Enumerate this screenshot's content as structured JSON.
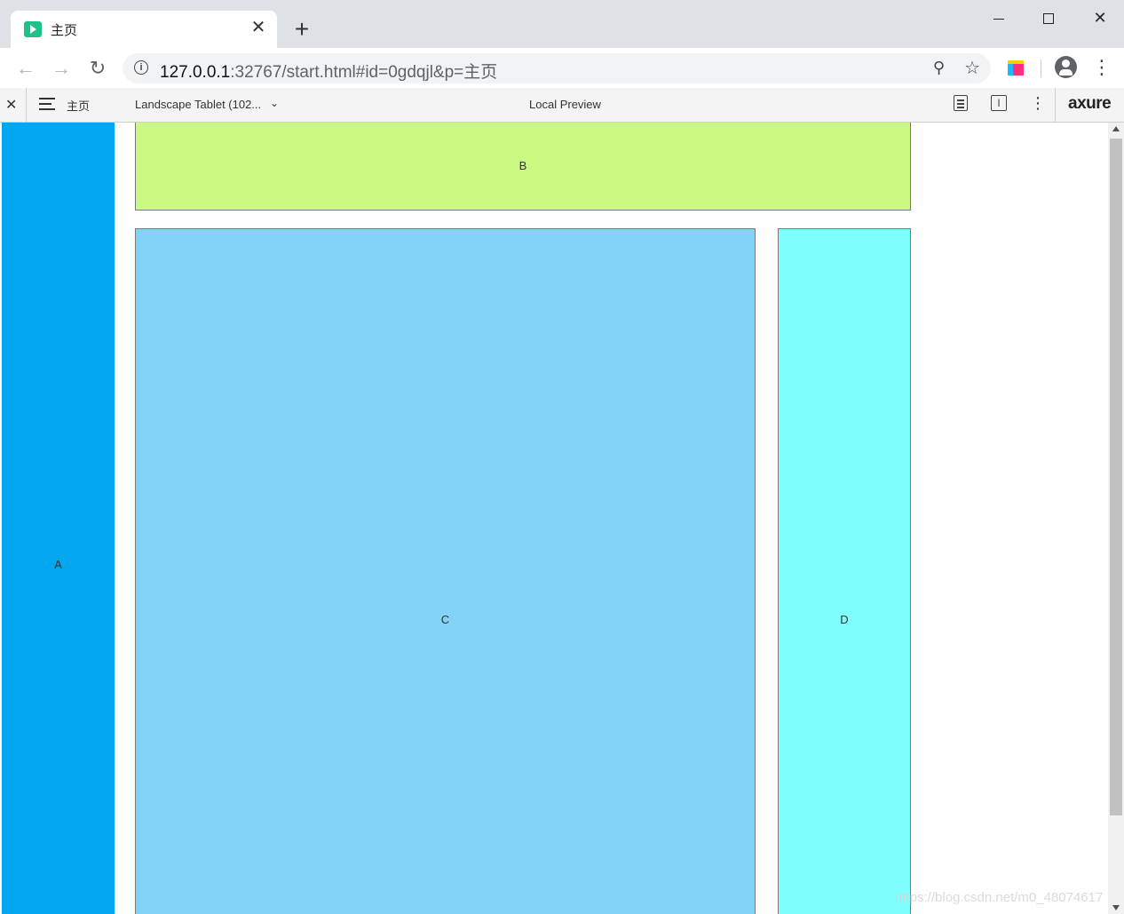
{
  "browser": {
    "tab_title": "主页",
    "new_tab": "+",
    "tab_close": "✕",
    "url_host": "127.0.0.1",
    "url_rest": ":32767/start.html#id=0gdqjl&p=主页"
  },
  "axure": {
    "close": "✕",
    "page_name": "主页",
    "device": "Landscape Tablet (102...",
    "preview_label": "Local Preview",
    "logo": "axure"
  },
  "canvas": {
    "box_a": "A",
    "box_b": "B",
    "box_c": "C",
    "box_d": "D"
  },
  "watermark": "https://blog.csdn.net/m0_48074617",
  "colors": {
    "box_a": "#02a7f0",
    "box_b": "#caf982",
    "box_c": "#81d3f8",
    "box_d": "#80ffff"
  }
}
